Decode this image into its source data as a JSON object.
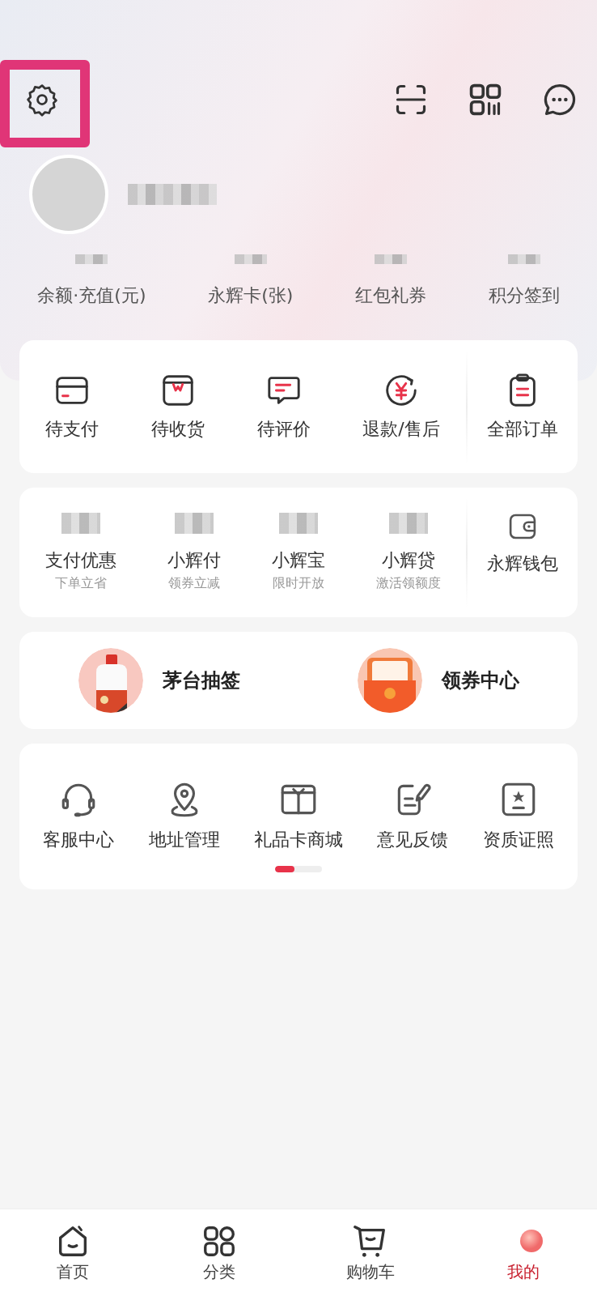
{
  "header": {
    "settings": {
      "highlighted": true
    }
  },
  "stats": [
    {
      "label": "余额·充值(元)"
    },
    {
      "label": "永辉卡(张)"
    },
    {
      "label": "红包礼券"
    },
    {
      "label": "积分签到"
    }
  ],
  "orders": {
    "items": [
      {
        "label": "待支付",
        "kind": "card"
      },
      {
        "label": "待收货",
        "kind": "box"
      },
      {
        "label": "待评价",
        "kind": "chat"
      },
      {
        "label": "退款/售后",
        "kind": "yen"
      }
    ],
    "all": {
      "label": "全部订单",
      "kind": "clipboard"
    }
  },
  "finance": {
    "items": [
      {
        "label": "支付优惠",
        "sub": "下单立省"
      },
      {
        "label": "小辉付",
        "sub": "领券立减"
      },
      {
        "label": "小辉宝",
        "sub": "限时开放"
      },
      {
        "label": "小辉贷",
        "sub": "激活领额度"
      }
    ],
    "wallet": {
      "label": "永辉钱包",
      "kind": "wallet"
    }
  },
  "promos": [
    {
      "label": "茅台抽签",
      "kind": "bottle"
    },
    {
      "label": "领券中心",
      "kind": "coupon"
    }
  ],
  "services": [
    {
      "label": "客服中心",
      "kind": "headset"
    },
    {
      "label": "地址管理",
      "kind": "pin"
    },
    {
      "label": "礼品卡商城",
      "kind": "gift"
    },
    {
      "label": "意见反馈",
      "kind": "feedback"
    },
    {
      "label": "资质证照",
      "kind": "license"
    }
  ],
  "tabs": [
    {
      "label": "首页",
      "kind": "home",
      "selected": false
    },
    {
      "label": "分类",
      "kind": "grid",
      "selected": false
    },
    {
      "label": "购物车",
      "kind": "cart",
      "selected": false
    },
    {
      "label": "我的",
      "kind": "me",
      "selected": true
    }
  ]
}
